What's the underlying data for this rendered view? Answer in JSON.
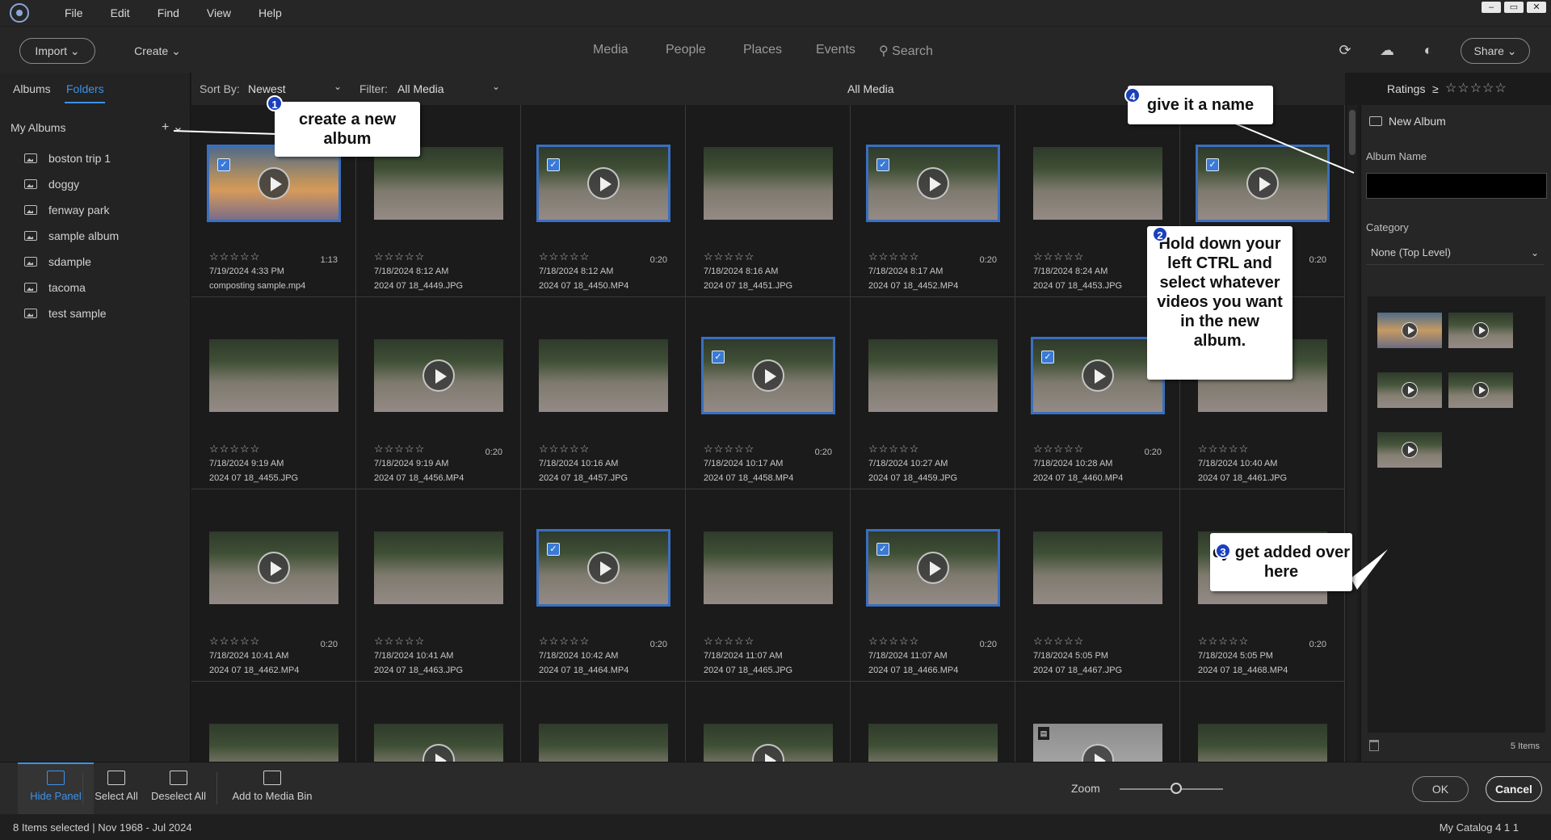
{
  "menu": [
    "File",
    "Edit",
    "Find",
    "View",
    "Help"
  ],
  "window_controls": [
    "–",
    "▭",
    "✕"
  ],
  "topnav": {
    "import": "Import ⌄",
    "create": "Create ⌄",
    "tabs": [
      "Media",
      "People",
      "Places",
      "Events"
    ],
    "search": "Search",
    "share": "Share ⌄"
  },
  "left": {
    "tabs": [
      "Albums",
      "Folders"
    ],
    "my_albums": "My Albums",
    "add": "+ ⌄",
    "albums": [
      "boston trip 1",
      "doggy",
      "fenway park",
      "sample album",
      "sdample",
      "tacoma",
      "test sample"
    ]
  },
  "sortbar": {
    "sort_label": "Sort By:",
    "sort_value": "Newest",
    "filter_label": "Filter:",
    "filter_value": "All Media",
    "title": "All Media",
    "ratings_label": "Ratings",
    "ratings_op": "≥",
    "stars": "☆☆☆☆☆"
  },
  "grid": {
    "stars": "☆☆☆☆☆",
    "cells": [
      {
        "date": "7/19/2024 4:33 PM",
        "name": "composting sample.mp4",
        "dur": "1:13",
        "video": true,
        "selected": true,
        "thumb": "sky"
      },
      {
        "date": "7/18/2024 8:12 AM",
        "name": "2024 07 18_4449.JPG",
        "dur": "",
        "video": false,
        "selected": false,
        "thumb": "park"
      },
      {
        "date": "7/18/2024 8:12 AM",
        "name": "2024 07 18_4450.MP4",
        "dur": "0:20",
        "video": true,
        "selected": true,
        "thumb": "park"
      },
      {
        "date": "7/18/2024 8:16 AM",
        "name": "2024 07 18_4451.JPG",
        "dur": "",
        "video": false,
        "selected": false,
        "thumb": "park"
      },
      {
        "date": "7/18/2024 8:17 AM",
        "name": "2024 07 18_4452.MP4",
        "dur": "0:20",
        "video": true,
        "selected": true,
        "thumb": "park"
      },
      {
        "date": "7/18/2024 8:24 AM",
        "name": "2024 07 18_4453.JPG",
        "dur": "",
        "video": false,
        "selected": false,
        "thumb": "park"
      },
      {
        "date": "",
        "name": "",
        "dur": "0:20",
        "video": true,
        "selected": true,
        "thumb": "park"
      },
      {
        "date": "7/18/2024 9:19 AM",
        "name": "2024 07 18_4455.JPG",
        "dur": "",
        "video": false,
        "selected": false,
        "thumb": "park"
      },
      {
        "date": "7/18/2024 9:19 AM",
        "name": "2024 07 18_4456.MP4",
        "dur": "0:20",
        "video": true,
        "selected": false,
        "thumb": "park"
      },
      {
        "date": "7/18/2024 10:16 AM",
        "name": "2024 07 18_4457.JPG",
        "dur": "",
        "video": false,
        "selected": false,
        "thumb": "park"
      },
      {
        "date": "7/18/2024 10:17 AM",
        "name": "2024 07 18_4458.MP4",
        "dur": "0:20",
        "video": true,
        "selected": true,
        "thumb": "park"
      },
      {
        "date": "7/18/2024 10:27 AM",
        "name": "2024 07 18_4459.JPG",
        "dur": "",
        "video": false,
        "selected": false,
        "thumb": "park"
      },
      {
        "date": "7/18/2024 10:28 AM",
        "name": "2024 07 18_4460.MP4",
        "dur": "0:20",
        "video": true,
        "selected": true,
        "thumb": "park"
      },
      {
        "date": "7/18/2024 10:40 AM",
        "name": "2024 07 18_4461.JPG",
        "dur": "",
        "video": false,
        "selected": false,
        "thumb": "park"
      },
      {
        "date": "7/18/2024 10:41 AM",
        "name": "2024 07 18_4462.MP4",
        "dur": "0:20",
        "video": true,
        "selected": false,
        "thumb": "park"
      },
      {
        "date": "7/18/2024 10:41 AM",
        "name": "2024 07 18_4463.JPG",
        "dur": "",
        "video": false,
        "selected": false,
        "thumb": "park"
      },
      {
        "date": "7/18/2024 10:42 AM",
        "name": "2024 07 18_4464.MP4",
        "dur": "0:20",
        "video": true,
        "selected": true,
        "thumb": "park"
      },
      {
        "date": "7/18/2024 11:07 AM",
        "name": "2024 07 18_4465.JPG",
        "dur": "",
        "video": false,
        "selected": false,
        "thumb": "park"
      },
      {
        "date": "7/18/2024 11:07 AM",
        "name": "2024 07 18_4466.MP4",
        "dur": "0:20",
        "video": true,
        "selected": true,
        "thumb": "park"
      },
      {
        "date": "7/18/2024 5:05 PM",
        "name": "2024 07 18_4467.JPG",
        "dur": "",
        "video": false,
        "selected": false,
        "thumb": "park"
      },
      {
        "date": "7/18/2024 5:05 PM",
        "name": "2024 07 18_4468.MP4",
        "dur": "0:20",
        "video": true,
        "selected": false,
        "thumb": "park"
      },
      {
        "date": "",
        "name": "",
        "dur": "",
        "video": false,
        "selected": false,
        "thumb": "park"
      },
      {
        "date": "",
        "name": "",
        "dur": "",
        "video": true,
        "selected": false,
        "thumb": "park"
      },
      {
        "date": "",
        "name": "",
        "dur": "",
        "video": false,
        "selected": false,
        "thumb": "park"
      },
      {
        "date": "",
        "name": "",
        "dur": "",
        "video": true,
        "selected": false,
        "thumb": "park"
      },
      {
        "date": "",
        "name": "",
        "dur": "",
        "video": false,
        "selected": false,
        "thumb": "park"
      },
      {
        "date": "",
        "name": "",
        "dur": "",
        "video": true,
        "selected": false,
        "thumb": "grey",
        "doc": true
      },
      {
        "date": "",
        "name": "",
        "dur": "",
        "video": false,
        "selected": false,
        "thumb": "park"
      }
    ]
  },
  "right": {
    "title": "New Album",
    "name_label": "Album Name",
    "category_label": "Category",
    "category_value": "None (Top Level)",
    "items": "5 Items",
    "bin": [
      {
        "thumb": "sky"
      },
      {
        "thumb": "park"
      },
      {
        "thumb": "park"
      },
      {
        "thumb": "park"
      },
      {
        "thumb": "park"
      }
    ]
  },
  "bottom": {
    "hide_panel": "Hide Panel",
    "select_all": "Select All",
    "deselect_all": "Deselect All",
    "add_to_bin": "Add to Media Bin",
    "zoom": "Zoom",
    "zoom_level": 0.55,
    "ok": "OK",
    "cancel": "Cancel"
  },
  "status": {
    "left": "8 Items selected | Nov 1968 - Jul 2024",
    "right": "My Catalog 4 1 1"
  },
  "callouts": {
    "c1": {
      "num": "1",
      "text": "create a new album"
    },
    "c2": {
      "num": "2",
      "text": "Hold down your left CTRL and select whatever videos you want in the new album."
    },
    "c3": {
      "num": "3",
      "text": "ey get added over here"
    },
    "c4": {
      "num": "4",
      "text": "give it a name"
    }
  }
}
